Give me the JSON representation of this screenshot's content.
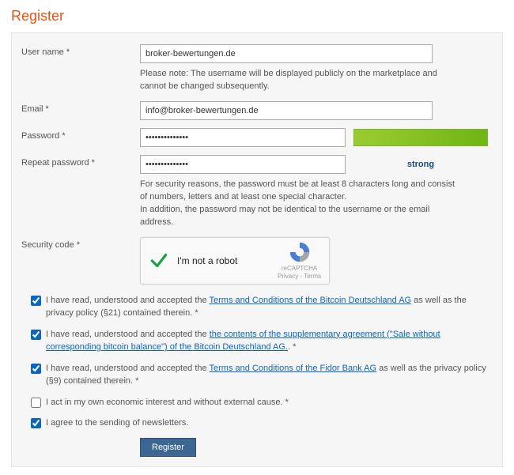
{
  "title": "Register",
  "fields": {
    "username": {
      "label": "User name *",
      "value": "broker-bewertungen.de",
      "help": "Please note: The username will be displayed publicly on the marketplace and cannot be changed subsequently."
    },
    "email": {
      "label": "Email *",
      "value": "info@broker-bewertungen.de"
    },
    "password": {
      "label": "Password *",
      "value": "••••••••••••••",
      "strength_label": "strong"
    },
    "repeat_password": {
      "label": "Repeat password *",
      "value": "••••••••••••••",
      "help": "For security reasons, the password must be at least 8 characters long and consist of numbers, letters and at least one special character.\nIn addition, the password may not be identical to the username or the email address."
    },
    "security_code": {
      "label": "Security code *",
      "captcha_text": "I'm not a robot",
      "captcha_brand": "reCAPTCHA",
      "captcha_privacy": "Privacy - Terms"
    }
  },
  "agreements": {
    "terms_bitcoin": {
      "checked": true,
      "pre": "I have read, understood and accepted the ",
      "link": "Terms and Conditions of the Bitcoin Deutschland AG",
      "post": " as well as the privacy policy (§21) contained therein. *"
    },
    "supp_agreement": {
      "checked": true,
      "pre": "I have read, understood and accepted the ",
      "link": "the contents of the supplementary agreement (\"Sale without corresponding bitcoin balance\") of the Bitcoin Deutschland AG.",
      "post": ". *"
    },
    "terms_fidor": {
      "checked": true,
      "pre": "I have read, understood and accepted the ",
      "link": "Terms and Conditions of the Fidor Bank AG",
      "post": " as well as the privacy policy (§9) contained therein. *"
    },
    "own_interest": {
      "checked": false,
      "text": "I act in my own economic interest and without external cause. *"
    },
    "newsletter": {
      "checked": true,
      "text": "I agree to the sending of newsletters."
    }
  },
  "submit_label": "Register"
}
